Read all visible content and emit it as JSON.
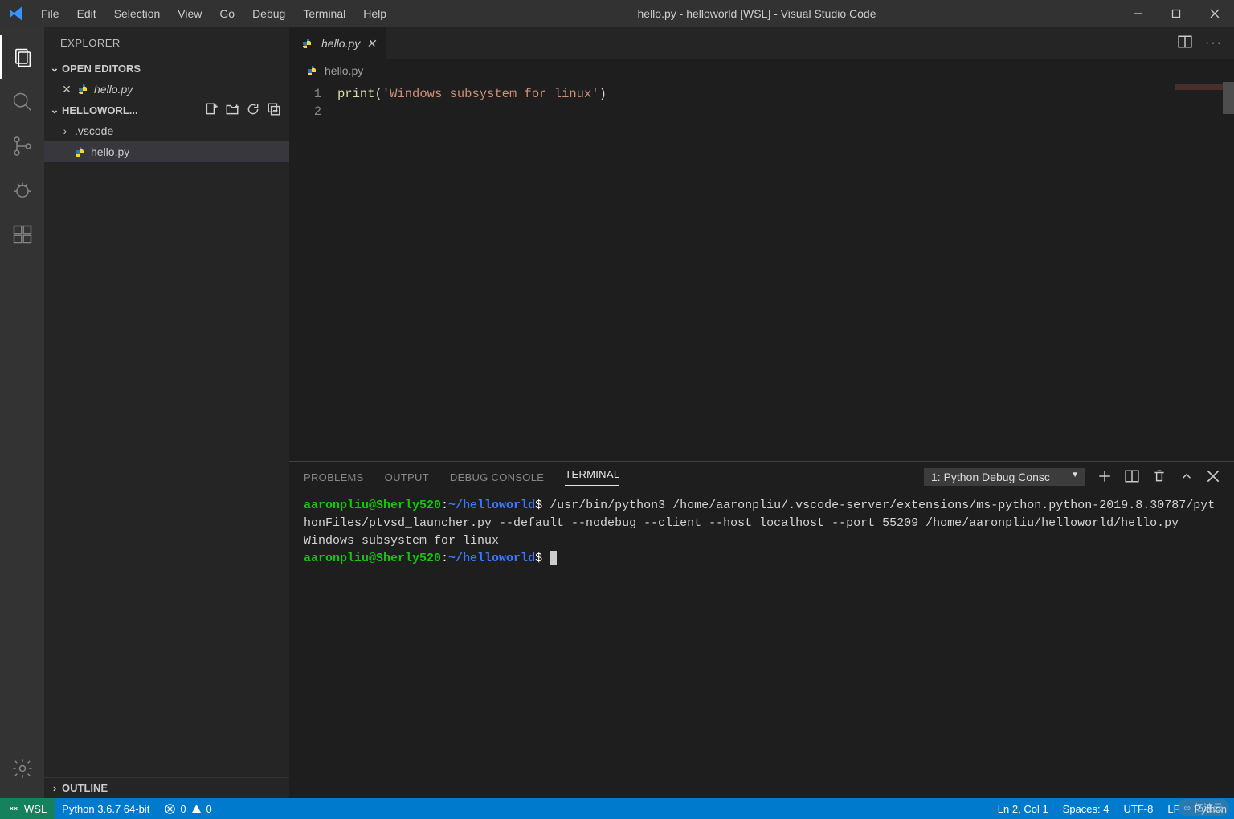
{
  "titlebar": {
    "menus": [
      "File",
      "Edit",
      "Selection",
      "View",
      "Go",
      "Debug",
      "Terminal",
      "Help"
    ],
    "title": "hello.py - helloworld [WSL] - Visual Studio Code"
  },
  "sidebar": {
    "title": "EXPLORER",
    "open_editors_label": "OPEN EDITORS",
    "open_editors": [
      {
        "name": "hello.py",
        "italic": true
      }
    ],
    "workspace_label": "HELLOWORL...",
    "tree": [
      {
        "name": ".vscode",
        "type": "folder"
      },
      {
        "name": "hello.py",
        "type": "file",
        "selected": true
      }
    ],
    "outline_label": "OUTLINE"
  },
  "editor": {
    "tab_name": "hello.py",
    "breadcrumb": "hello.py",
    "lines": [
      {
        "num": "1",
        "tokens": [
          {
            "t": "print",
            "c": "tok-fn"
          },
          {
            "t": "(",
            "c": "tok-punc"
          },
          {
            "t": "'Windows subsystem for linux'",
            "c": "tok-str"
          },
          {
            "t": ")",
            "c": "tok-punc"
          }
        ]
      },
      {
        "num": "2",
        "tokens": []
      }
    ]
  },
  "panel": {
    "tabs": [
      "PROBLEMS",
      "OUTPUT",
      "DEBUG CONSOLE",
      "TERMINAL"
    ],
    "active_tab": "TERMINAL",
    "selector": "1: Python Debug Consc",
    "terminal": {
      "user1": "aaronpliu@Sherly520",
      "path1": "~/helloworld",
      "cmd": "/usr/bin/python3 /home/aaronpliu/.vscode-server/extensions/ms-python.python-2019.8.30787/pythonFiles/ptvsd_launcher.py --default --nodebug --client --host localhost --port 55209 /home/aaronpliu/helloworld/hello.py",
      "output": "Windows subsystem for linux",
      "user2": "aaronpliu@Sherly520",
      "path2": "~/helloworld"
    }
  },
  "statusbar": {
    "remote": "WSL",
    "python": "Python 3.6.7 64-bit",
    "errors": "0",
    "warnings": "0",
    "cursor": "Ln 2, Col 1",
    "spaces": "Spaces: 4",
    "encoding": "UTF-8",
    "eol": "LF",
    "lang": "Python"
  },
  "watermark": "亿速云"
}
